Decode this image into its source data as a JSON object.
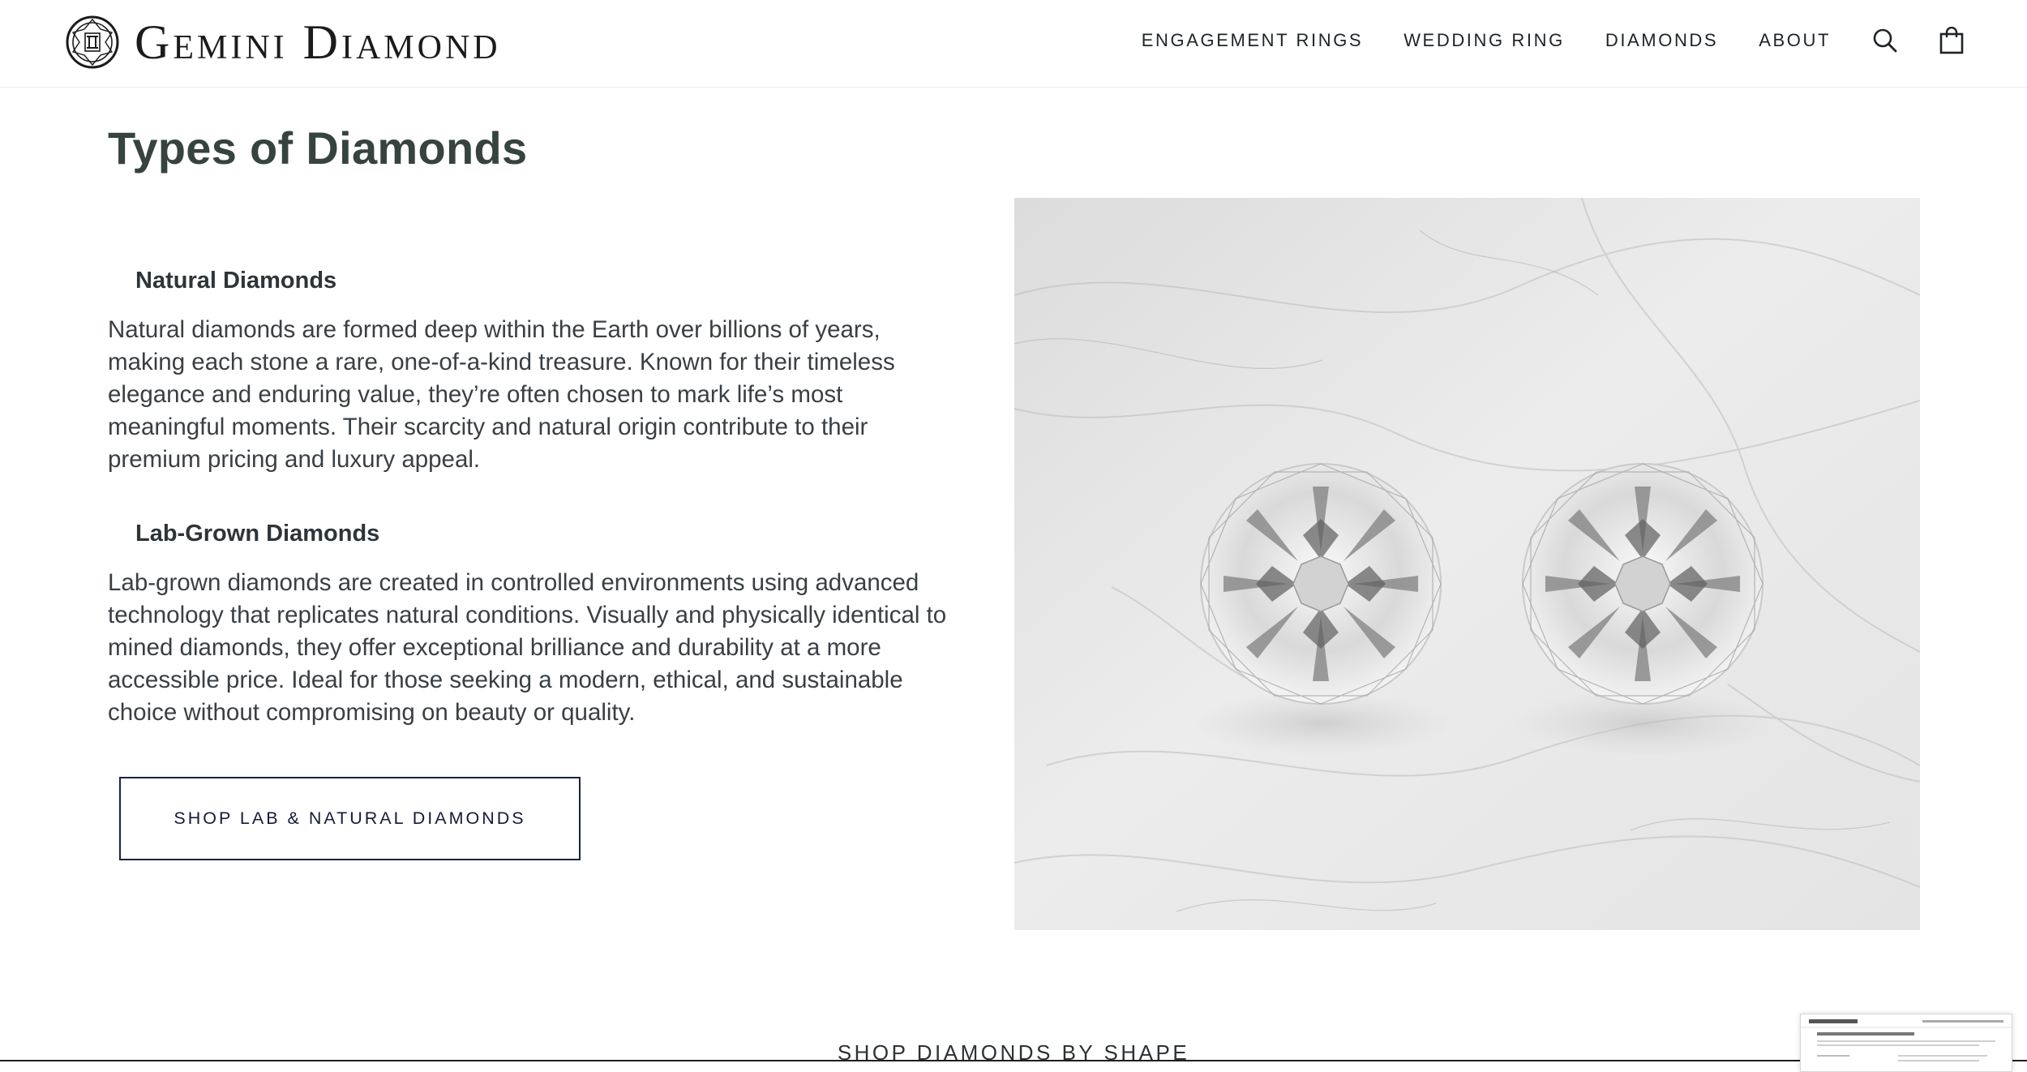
{
  "header": {
    "logo_text": "Gemini Diamond",
    "nav": [
      {
        "label": "ENGAGEMENT RINGS"
      },
      {
        "label": "WEDDING RING"
      },
      {
        "label": "DIAMONDS"
      },
      {
        "label": "ABOUT"
      }
    ],
    "icons": {
      "search": "search-icon",
      "cart": "shopping-bag-icon"
    }
  },
  "main": {
    "title": "Types of Diamonds",
    "natural": {
      "heading": "Natural Diamonds",
      "lines": [
        "Natural diamonds are formed deep within the Earth over billions of years,",
        "making each stone a rare, one-of-a-kind treasure. Known for their timeless",
        "elegance and enduring value, they’re often chosen to mark life’s most",
        "meaningful moments. Their scarcity and natural origin contribute to their",
        "premium pricing and luxury appeal."
      ]
    },
    "lab": {
      "heading": "Lab-Grown Diamonds",
      "lines": [
        "Lab-grown diamonds are created in controlled environments using advanced",
        "technology that replicates natural conditions. Visually and physically identical to",
        "mined diamonds, they offer exceptional brilliance and durability at a more",
        "accessible price. Ideal for those seeking a modern, ethical, and sustainable",
        "choice without compromising on beauty or quality."
      ]
    },
    "cta_label": "SHOP LAB & NATURAL DIAMONDS",
    "image": "two-round-diamonds-on-marble"
  },
  "next_section": {
    "label": "SHOP DIAMONDS BY SHAPE"
  },
  "colors": {
    "title": "#36433f",
    "text": "#3a3f43",
    "cta_border": "#1c2340",
    "marble": "#e7e7e7"
  }
}
